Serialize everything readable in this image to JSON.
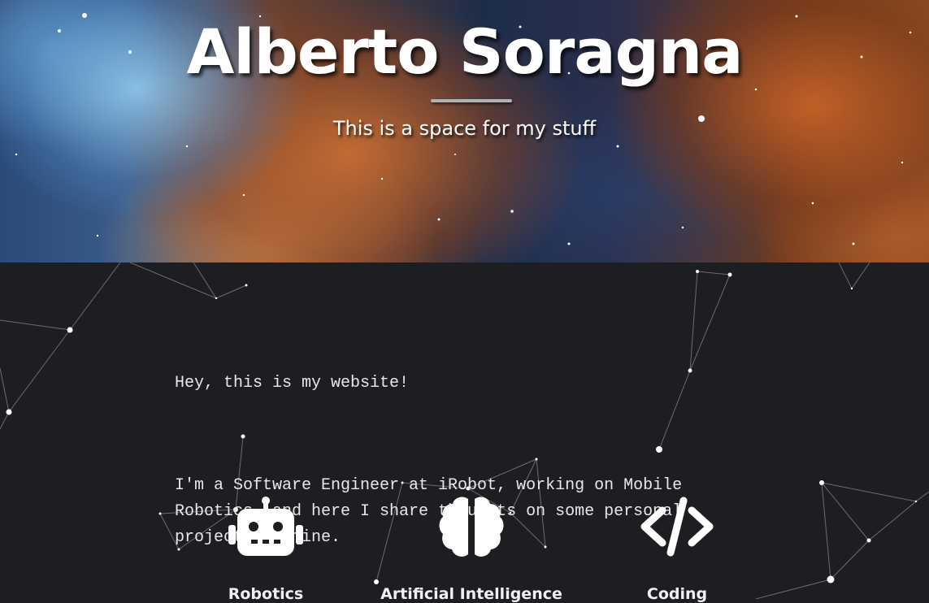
{
  "hero": {
    "title": "Alberto Soragna",
    "subtitle": "This is a space for my stuff"
  },
  "intro": {
    "greeting": "Hey, this is my website!",
    "description": "I'm a Software Engineer at iRobot, working on Mobile Robotics, and here I share thoughts on some personal projects of mine."
  },
  "features": [
    {
      "label": "Robotics",
      "icon": "robot-icon"
    },
    {
      "label": "Artificial Intelligence",
      "icon": "brain-icon"
    },
    {
      "label": "Coding",
      "icon": "code-icon"
    }
  ],
  "colors": {
    "background": "#1d1e22",
    "text": "#ffffff",
    "divider": "#aeb3b8"
  }
}
